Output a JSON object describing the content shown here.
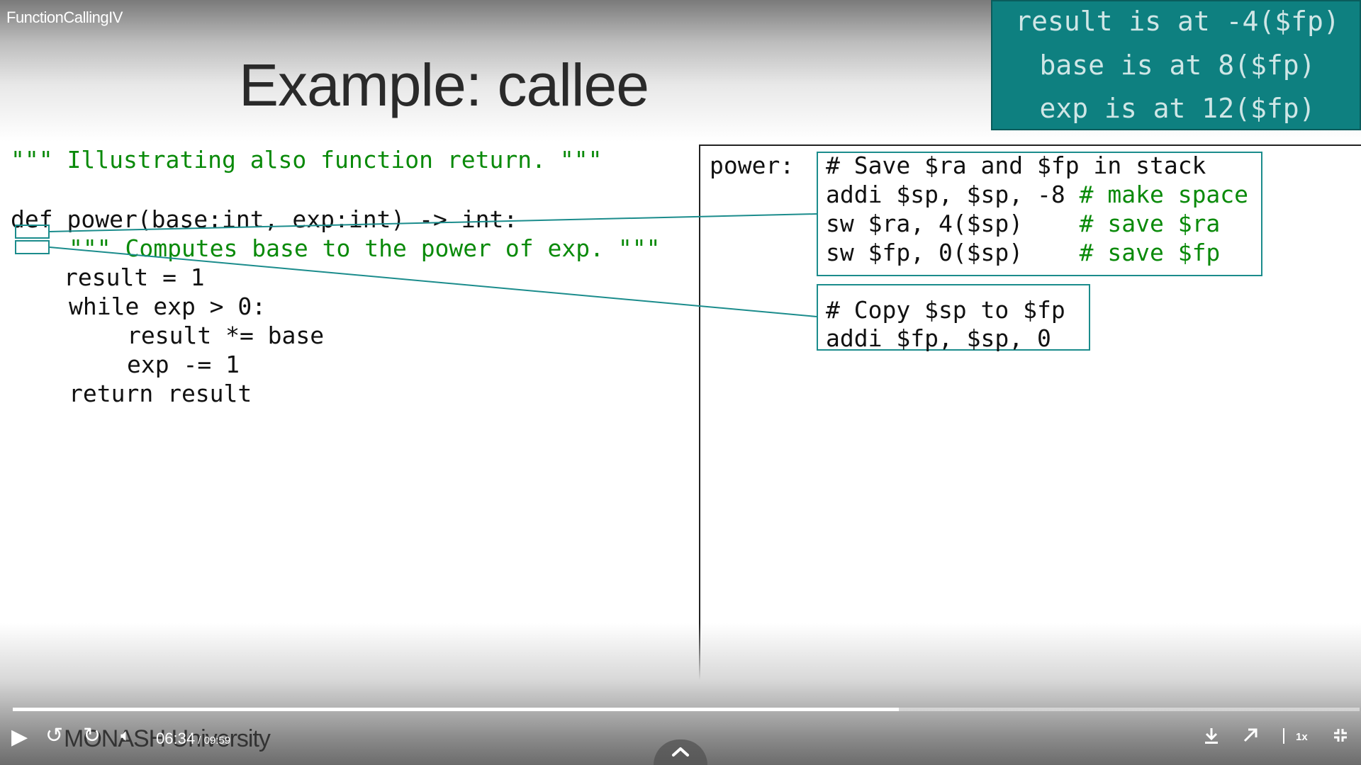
{
  "player": {
    "video_title": "FunctionCallingIV",
    "current_time": "06:34",
    "time_separator": " / ",
    "total_time": "09:59",
    "progress_percent": 65.8,
    "speed": "1x",
    "brand_text": "MONASH University"
  },
  "slide": {
    "title": "Example: callee",
    "info_box": {
      "lines": [
        "result is at -4($fp)",
        "base is at 8($fp)",
        "exp is at 12($fp)"
      ]
    },
    "python_code": {
      "docstring_top": "\"\"\" Illustrating also function return. \"\"\"",
      "def_line": "def power(base:int, exp:int) -> int:",
      "docstring_inner": "\"\"\" Computes base to the power of exp. \"\"\"",
      "line_result_init": "result = 1",
      "line_while": "while exp > 0:",
      "line_mul": "result *= base",
      "line_dec": "exp -= 1",
      "line_return": "return result"
    },
    "asm": {
      "label": "power:",
      "block1": {
        "comment": "# Save $ra and $fp in stack",
        "line1_code": "addi $sp, $sp, -8 ",
        "line1_comment": "# make space",
        "line2_code": "sw $ra, 4($sp)    ",
        "line2_comment": "# save $ra",
        "line3_code": "sw $fp, 0($sp)    ",
        "line3_comment": "# save $fp"
      },
      "block2": {
        "comment": "# Copy $sp to $fp",
        "line1_code": "addi $fp, $sp, 0"
      }
    }
  },
  "colors": {
    "teal_box": "#0e8080",
    "callout_border": "#1b8c8c",
    "comment_green": "#0a8a0a"
  }
}
